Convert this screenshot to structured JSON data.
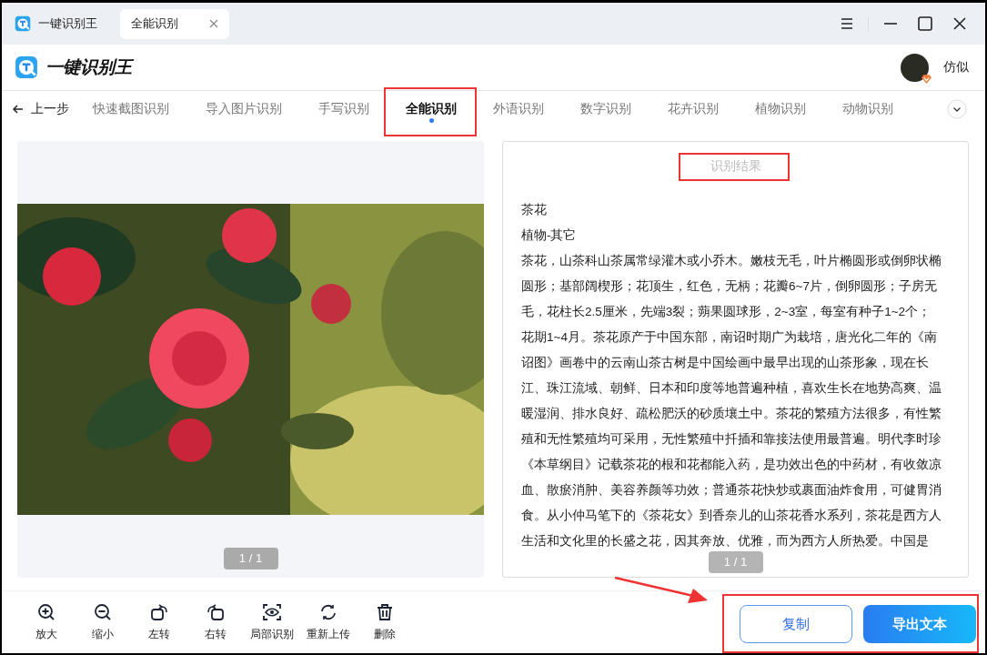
{
  "window": {
    "app_tab": "一键识别王",
    "tabs": [
      {
        "label": "全能识别",
        "selected": true
      }
    ]
  },
  "header": {
    "logo_text": "一键识别王",
    "user_name": "仿似"
  },
  "nav": {
    "back": "上一步",
    "tabs": [
      {
        "label": "快速截图识别",
        "selected": false
      },
      {
        "label": "导入图片识别",
        "selected": false
      },
      {
        "label": "手写识别",
        "selected": false
      },
      {
        "label": "全能识别",
        "selected": true
      },
      {
        "label": "外语识别",
        "selected": false
      },
      {
        "label": "数字识别",
        "selected": false
      },
      {
        "label": "花卉识别",
        "selected": false
      },
      {
        "label": "植物识别",
        "selected": false
      },
      {
        "label": "动物识别",
        "selected": false
      }
    ]
  },
  "image_panel": {
    "page_badge": "1 / 1"
  },
  "result_panel": {
    "title": "识别结果",
    "lines": [
      "茶花",
      "植物-其它"
    ],
    "body_lines": [
      "茶花，山茶科山茶属常绿灌木或小乔木。嫩枝无毛，叶片椭圆形或倒卵状椭",
      "圆形；基部阔楔形；花顶生，红色，无柄；花瓣6~7片，倒卵圆形；子房无",
      "毛，花柱长2.5厘米，先端3裂；蒴果圆球形，2~3室，每室有种子1~2个；",
      "花期1~4月。茶花原产于中国东部，南诏时期广为栽培，唐光化二年的《南",
      "诏图》画卷中的云南山茶古树是中国绘画中最早出现的山茶形象，现在长",
      "江、珠江流域、朝鲜、日本和印度等地普遍种植，喜欢生长在地势高爽、温",
      "暖湿润、排水良好、疏松肥沃的砂质壤土中。茶花的繁殖方法很多，有性繁",
      "殖和无性繁殖均可采用，无性繁殖中扦插和靠接法使用最普遍。明代李时珍",
      "《本草纲目》记载茶花的根和花都能入药，是功效出色的中药材，有收敛凉",
      "血、散瘀消肿、美容养颜等功效；普通茶花快炒或裹面油炸食用，可健胃消",
      "食。从小仲马笔下的《茶花女》到香奈儿的山茶花香水系列，茶花是西方人",
      "生活和文化里的长盛之花，因其奔放、优雅，而为西方人所热爱。中国是"
    ],
    "page_badge": "1 / 1"
  },
  "toolbar": [
    {
      "kind": "zoom-in",
      "label": "放大"
    },
    {
      "kind": "zoom-out",
      "label": "缩小"
    },
    {
      "kind": "rotate-left",
      "label": "左转"
    },
    {
      "kind": "rotate-right",
      "label": "右转"
    },
    {
      "kind": "eye",
      "label": "局部识别"
    },
    {
      "kind": "refresh",
      "label": "重新上传"
    },
    {
      "kind": "trash",
      "label": "删除"
    }
  ],
  "actions": [
    {
      "kind": "outline",
      "label": "复制"
    },
    {
      "kind": "primary",
      "label": "导出文本"
    }
  ]
}
